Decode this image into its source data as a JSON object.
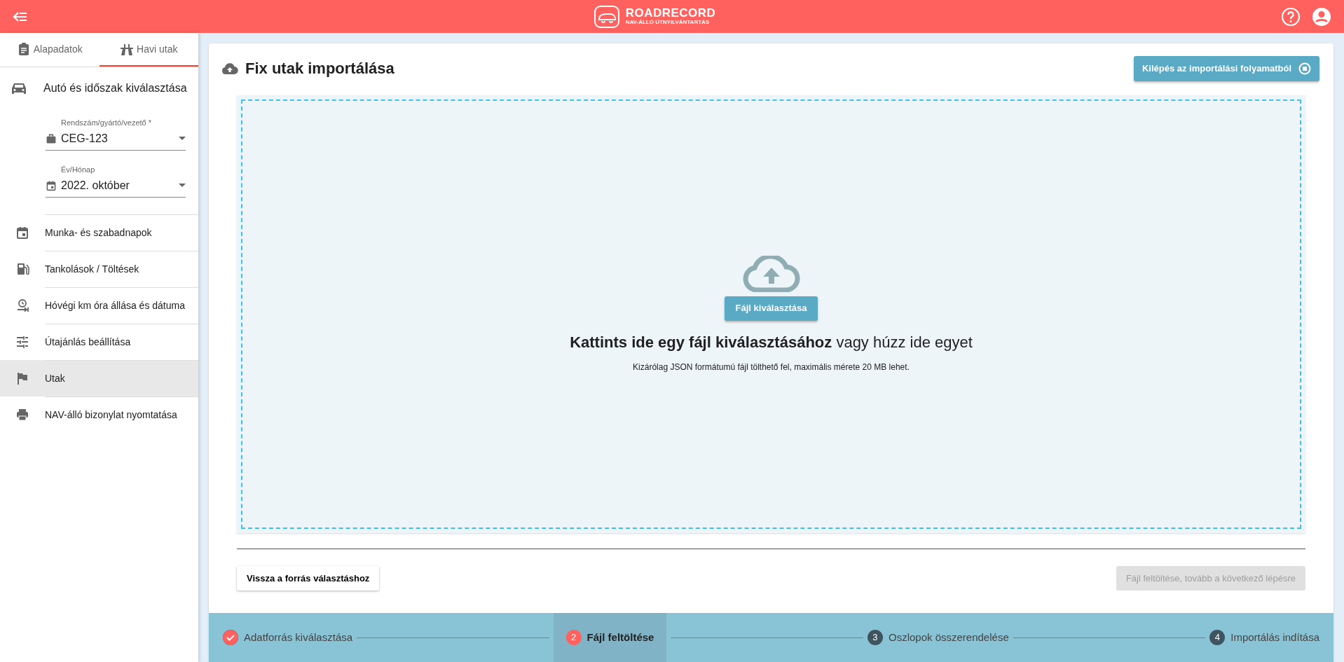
{
  "header": {
    "logo_title": "ROADRECORD",
    "logo_subtitle": "NAV-ÁLLÓ ÚTNYILVÁNTARTÁS"
  },
  "sidebar": {
    "tabs": [
      {
        "label": "Alapadatok",
        "selected": false
      },
      {
        "label": "Havi utak",
        "selected": true
      }
    ],
    "section_title": "Autó és időszak kiválasztása",
    "fields": [
      {
        "label": "Rendszám/gyártó/vezető *",
        "value": "CEG-123"
      },
      {
        "label": "Év/Hónap",
        "value": "2022. október"
      }
    ],
    "items": [
      {
        "label": "Munka- és szabadnapok",
        "selected": false
      },
      {
        "label": "Tankolások / Töltések",
        "selected": false
      },
      {
        "label": "Hóvégi km óra állása és dátuma",
        "selected": false
      },
      {
        "label": "Útajánlás beállítása",
        "selected": false
      },
      {
        "label": "Utak",
        "selected": true
      },
      {
        "label": "NAV-álló bizonylat nyomtatása",
        "selected": false
      }
    ]
  },
  "main": {
    "title": "Fix utak importálása",
    "exit_button": "Kilépés az importálási folyamatból",
    "dropzone": {
      "button": "Fájl kiválasztása",
      "heading": "**Kattints ide egy fájl kiválasztásához** vagy húzz ide egyet",
      "note": "Kizárólag JSON formátumú fájl tölthető fel, maximális mérete 20 MB lehet."
    },
    "back_button": "Vissza a forrás választáshoz",
    "next_button": {
      "label": "Fájl feltöltése, tovább a következő lépésre",
      "disabled": true
    }
  },
  "stepper": [
    {
      "label": "Adatforrás kiválasztása",
      "completed": true,
      "selected": false
    },
    {
      "number": "2",
      "label": "Fájl feltöltése",
      "completed": false,
      "selected": true
    },
    {
      "number": "3",
      "label": "Oszlopok összerendelése",
      "completed": false,
      "selected": false
    },
    {
      "number": "4",
      "label": "Importálás indítása",
      "completed": false,
      "selected": false
    }
  ]
}
